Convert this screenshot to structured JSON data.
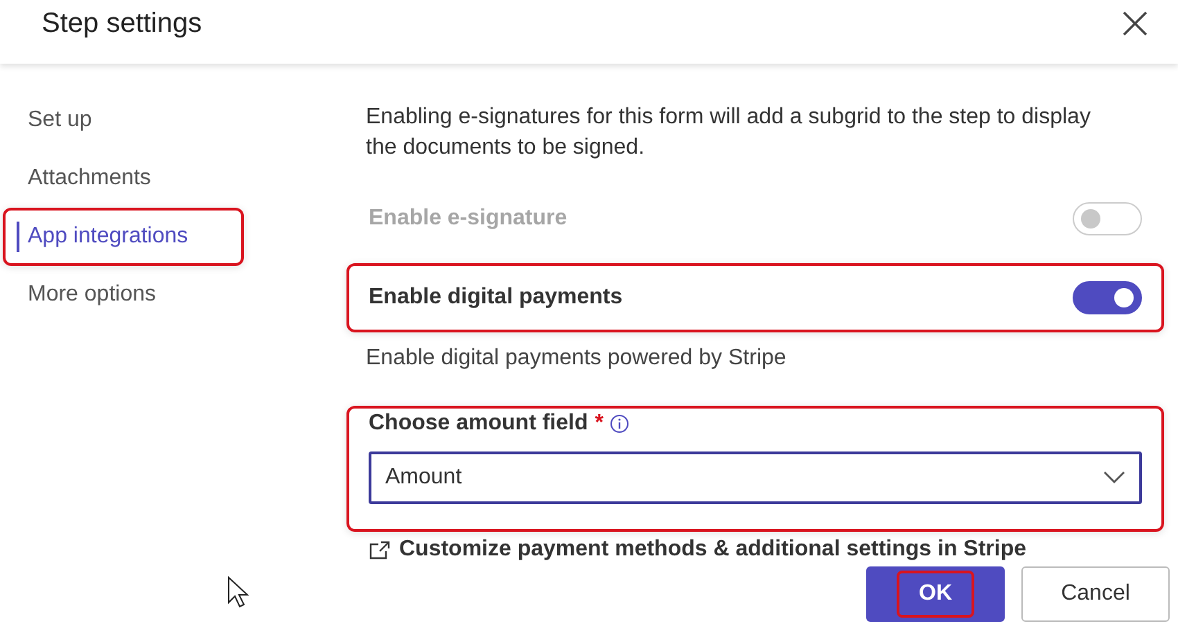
{
  "dialog": {
    "title": "Step settings"
  },
  "nav": [
    {
      "label": "Set up",
      "selected": false,
      "highlighted": false
    },
    {
      "label": "Attachments",
      "selected": false,
      "highlighted": false
    },
    {
      "label": "App integrations",
      "selected": true,
      "highlighted": true
    },
    {
      "label": "More options",
      "selected": false,
      "highlighted": false
    }
  ],
  "description": "Enabling e-signatures for this form will add a subgrid to the step to display the documents to be signed.",
  "toggles": [
    {
      "label": "Enable e-signature",
      "on": false,
      "disabled": true,
      "highlighted": false
    },
    {
      "label": "Enable digital payments",
      "on": true,
      "disabled": false,
      "highlighted": true
    }
  ],
  "toggle_note": "Enable digital payments powered by Stripe",
  "amount_field": {
    "label": "Choose amount field",
    "required_mark": "*",
    "value": "Amount",
    "highlighted": true
  },
  "link": "Customize payment methods & additional settings in Stripe",
  "buttons": [
    {
      "label": "OK",
      "kind": "primary",
      "highlighted": true
    },
    {
      "label": "Cancel",
      "kind": "secondary",
      "highlighted": false
    }
  ]
}
